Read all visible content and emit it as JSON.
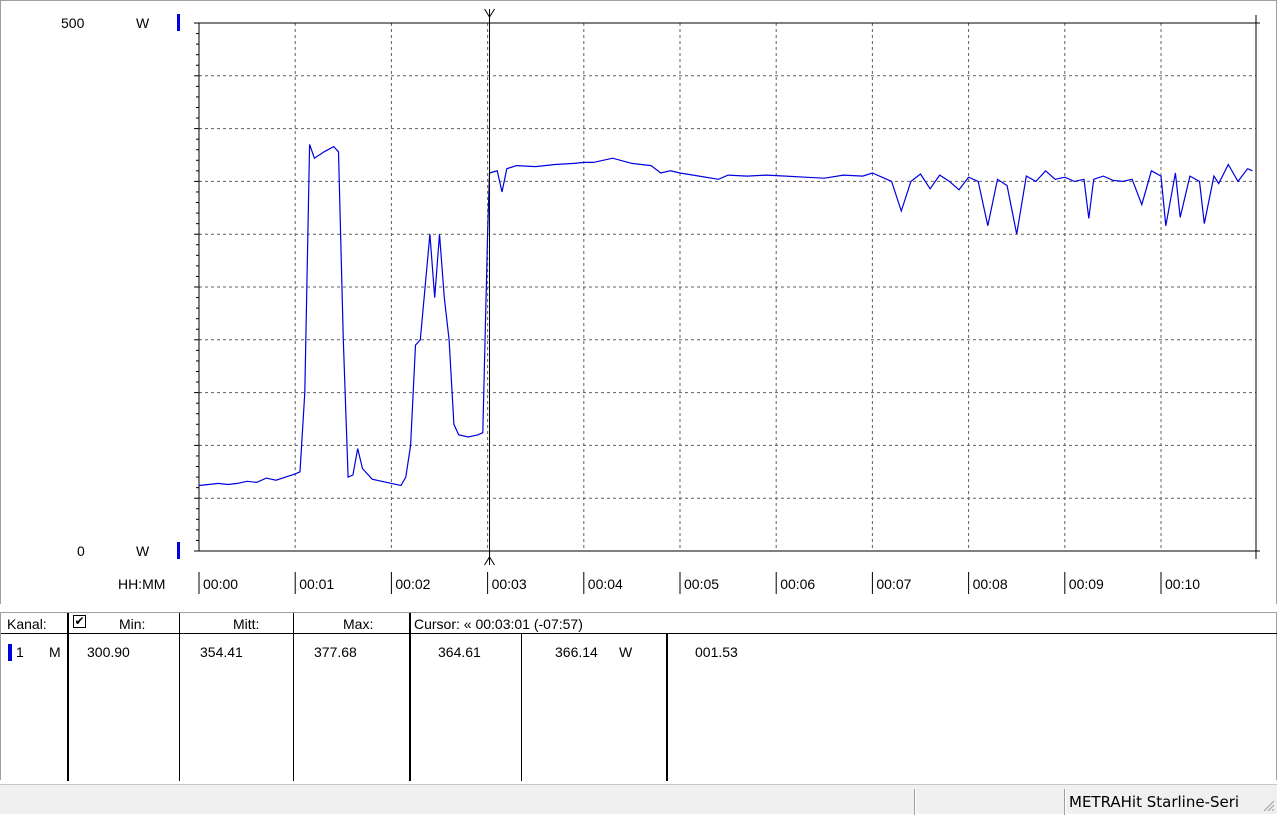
{
  "chart_data": {
    "type": "line",
    "y_axis": {
      "top_value": "500",
      "top_unit": "W",
      "bottom_value": "0",
      "bottom_unit": "W",
      "ylim": [
        0,
        500
      ]
    },
    "x_axis": {
      "label": "HH:MM",
      "ticks": [
        "00:00",
        "00:01",
        "00:02",
        "00:03",
        "00:04",
        "00:05",
        "00:06",
        "00:07",
        "00:08",
        "00:09",
        "00:10"
      ],
      "xlim_minutes": [
        0,
        10.95
      ]
    },
    "grid": true,
    "cursor_minutes": 3.02,
    "series": [
      {
        "color": "#0000e0",
        "points": [
          [
            0,
            62
          ],
          [
            0.1,
            63
          ],
          [
            0.2,
            64
          ],
          [
            0.3,
            63
          ],
          [
            0.4,
            64
          ],
          [
            0.5,
            66
          ],
          [
            0.6,
            65
          ],
          [
            0.7,
            69
          ],
          [
            0.8,
            67
          ],
          [
            0.9,
            70
          ],
          [
            1.0,
            73
          ],
          [
            1.05,
            75
          ],
          [
            1.1,
            150
          ],
          [
            1.15,
            385
          ],
          [
            1.2,
            372
          ],
          [
            1.3,
            378
          ],
          [
            1.4,
            383
          ],
          [
            1.45,
            378
          ],
          [
            1.5,
            200
          ],
          [
            1.55,
            70
          ],
          [
            1.6,
            72
          ],
          [
            1.65,
            97
          ],
          [
            1.7,
            78
          ],
          [
            1.8,
            68
          ],
          [
            1.9,
            66
          ],
          [
            2.0,
            64
          ],
          [
            2.1,
            62
          ],
          [
            2.15,
            70
          ],
          [
            2.2,
            100
          ],
          [
            2.25,
            195
          ],
          [
            2.3,
            200
          ],
          [
            2.35,
            250
          ],
          [
            2.4,
            300
          ],
          [
            2.45,
            240
          ],
          [
            2.5,
            300
          ],
          [
            2.55,
            240
          ],
          [
            2.6,
            200
          ],
          [
            2.65,
            120
          ],
          [
            2.7,
            110
          ],
          [
            2.8,
            108
          ],
          [
            2.9,
            110
          ],
          [
            2.95,
            112
          ],
          [
            3.0,
            300
          ],
          [
            3.02,
            358
          ],
          [
            3.1,
            360
          ],
          [
            3.15,
            340
          ],
          [
            3.2,
            362
          ],
          [
            3.3,
            365
          ],
          [
            3.5,
            364
          ],
          [
            3.7,
            366
          ],
          [
            3.9,
            367
          ],
          [
            4.0,
            368
          ],
          [
            4.1,
            368
          ],
          [
            4.3,
            372
          ],
          [
            4.5,
            367
          ],
          [
            4.7,
            365
          ],
          [
            4.8,
            358
          ],
          [
            4.9,
            360
          ],
          [
            5.0,
            358
          ],
          [
            5.2,
            355
          ],
          [
            5.4,
            352
          ],
          [
            5.5,
            356
          ],
          [
            5.7,
            355
          ],
          [
            5.9,
            356
          ],
          [
            6.1,
            355
          ],
          [
            6.3,
            354
          ],
          [
            6.5,
            353
          ],
          [
            6.7,
            356
          ],
          [
            6.9,
            355
          ],
          [
            7.0,
            358
          ],
          [
            7.2,
            350
          ],
          [
            7.3,
            322
          ],
          [
            7.4,
            350
          ],
          [
            7.5,
            357
          ],
          [
            7.6,
            343
          ],
          [
            7.7,
            356
          ],
          [
            7.8,
            350
          ],
          [
            7.9,
            342
          ],
          [
            8.0,
            354
          ],
          [
            8.1,
            350
          ],
          [
            8.2,
            308
          ],
          [
            8.3,
            352
          ],
          [
            8.4,
            346
          ],
          [
            8.5,
            300
          ],
          [
            8.6,
            355
          ],
          [
            8.7,
            350
          ],
          [
            8.8,
            360
          ],
          [
            8.9,
            352
          ],
          [
            9.0,
            354
          ],
          [
            9.1,
            350
          ],
          [
            9.2,
            352
          ],
          [
            9.25,
            315
          ],
          [
            9.3,
            352
          ],
          [
            9.4,
            355
          ],
          [
            9.5,
            351
          ],
          [
            9.6,
            350
          ],
          [
            9.7,
            352
          ],
          [
            9.8,
            328
          ],
          [
            9.9,
            360
          ],
          [
            10.0,
            355
          ],
          [
            10.05,
            308
          ],
          [
            10.15,
            358
          ],
          [
            10.2,
            316
          ],
          [
            10.3,
            355
          ],
          [
            10.4,
            350
          ],
          [
            10.45,
            310
          ],
          [
            10.55,
            355
          ],
          [
            10.6,
            348
          ],
          [
            10.7,
            366
          ],
          [
            10.8,
            350
          ],
          [
            10.9,
            362
          ],
          [
            10.95,
            360
          ]
        ]
      }
    ]
  },
  "table": {
    "headers": {
      "channel": "Kanal:",
      "min": "Min:",
      "mean": "Mitt:",
      "max": "Max:",
      "cursor": "Cursor: « 00:03:01 (-07:57)"
    },
    "rows": [
      {
        "channel": "1",
        "mode": "M",
        "min": "300.90",
        "mean": "354.41",
        "max": "377.68",
        "cursor_value": "364.61",
        "cursor_value2": "366.14",
        "unit": "W",
        "delta": "001.53"
      }
    ],
    "checkbox_checked": true,
    "checkbox_mark": "✔"
  },
  "status_bar": {
    "device": "METRAHit Starline-Seri"
  }
}
